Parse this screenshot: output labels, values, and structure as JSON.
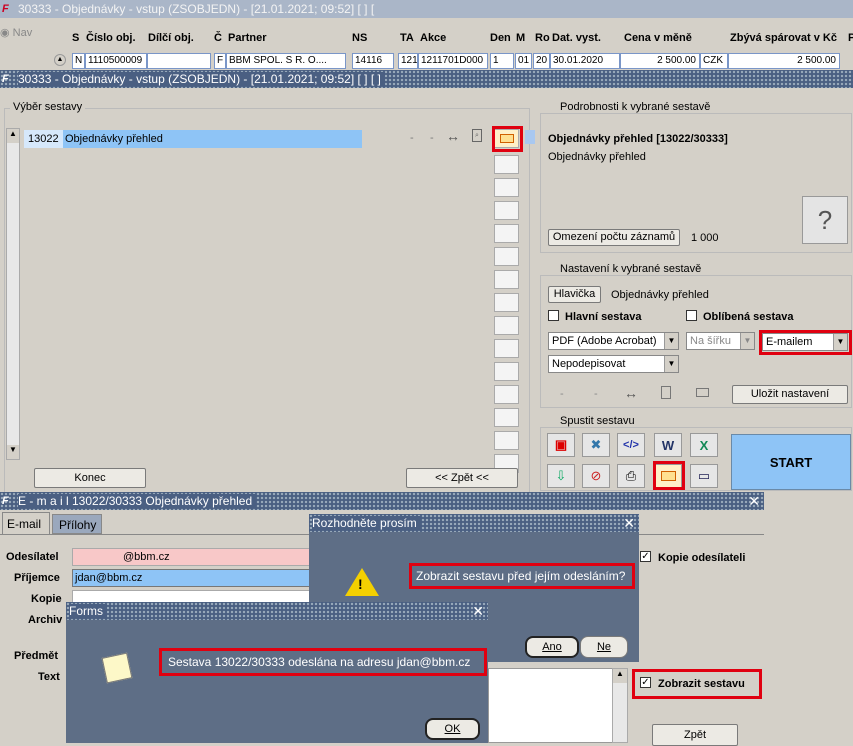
{
  "bg": {
    "title": "30333 - Objednávky - vstup (ZSOBJEDN) - [21.01.2021; 09:52]  [ ]  [",
    "nav": "Nav",
    "headers": [
      "S",
      "Číslo obj.",
      "Dílčí obj.",
      "Č",
      "Partner",
      "NS",
      "TA",
      "Akce",
      "Den",
      "M",
      "Ro",
      "Dat. vyst.",
      "Cena v měně",
      "Zbývá spárovat v Kč",
      "P"
    ],
    "row": [
      "N",
      "1110500009",
      "",
      "F",
      "BBM SPOL. S R. O....",
      "14116",
      "121",
      "1211701D000",
      "1",
      "01",
      "20",
      "30.01.2020",
      "2 500.00",
      "CZK",
      "2 500.00"
    ]
  },
  "win1": {
    "title": "30333 - Objednávky - vstup (ZSOBJEDN) - [21.01.2021; 09:52]  [ ]  [ ]",
    "vyber": "Výběr sestavy",
    "code": "13022",
    "name": "Objednávky přehled",
    "dash1": "-",
    "dash2": "-",
    "konec": "Konec",
    "zpet": "<< Zpět <<",
    "podrobnosti": "Podrobnosti k vybrané sestavě",
    "det_title": "Objednávky přehled [13022/30333]",
    "det_sub": "Objednávky přehled",
    "omezeni": "Omezení počtu záznamů",
    "omezeni_val": "1 000",
    "nastaveni": "Nastavení k vybrané sestavě",
    "hlavicka": "Hlavička",
    "hlavicka_val": "Objednávky přehled",
    "hlavni": "Hlavní sestava",
    "oblibena": "Oblíbená sestava",
    "format": "PDF (Adobe Acrobat)",
    "orient": "Na šířku",
    "delivery": "E-mailem",
    "podpis": "Nepodepisovat",
    "ulozit": "Uložit nastavení",
    "spustit": "Spustit sestavu",
    "start": "START"
  },
  "email": {
    "title": "E - m a i l    13022/30333 Objednávky přehled",
    "tab1": "E-mail",
    "tab2": "Přílohy",
    "l_odes": "Odesílatel",
    "l_prij": "Příjemce",
    "l_kopie": "Kopie",
    "l_arch": "Archiv",
    "l_pred": "Předmět",
    "l_text": "Text",
    "odes_val": "@bbm.cz",
    "prij_val": "jdan@bbm.cz",
    "kopie_odes": "Kopie odesílateli",
    "zobrazit": "Zobrazit sestavu",
    "zpet": "Zpět"
  },
  "dialog1": {
    "title": "Rozhodněte prosím",
    "msg": "Zobrazit sestavu před jejím odesláním?",
    "yes": "Ano",
    "no": "Ne"
  },
  "dialog2": {
    "title": "Forms",
    "msg": "Sestava 13022/30333 odeslána na adresu jdan@bbm.cz",
    "ok": "OK"
  }
}
